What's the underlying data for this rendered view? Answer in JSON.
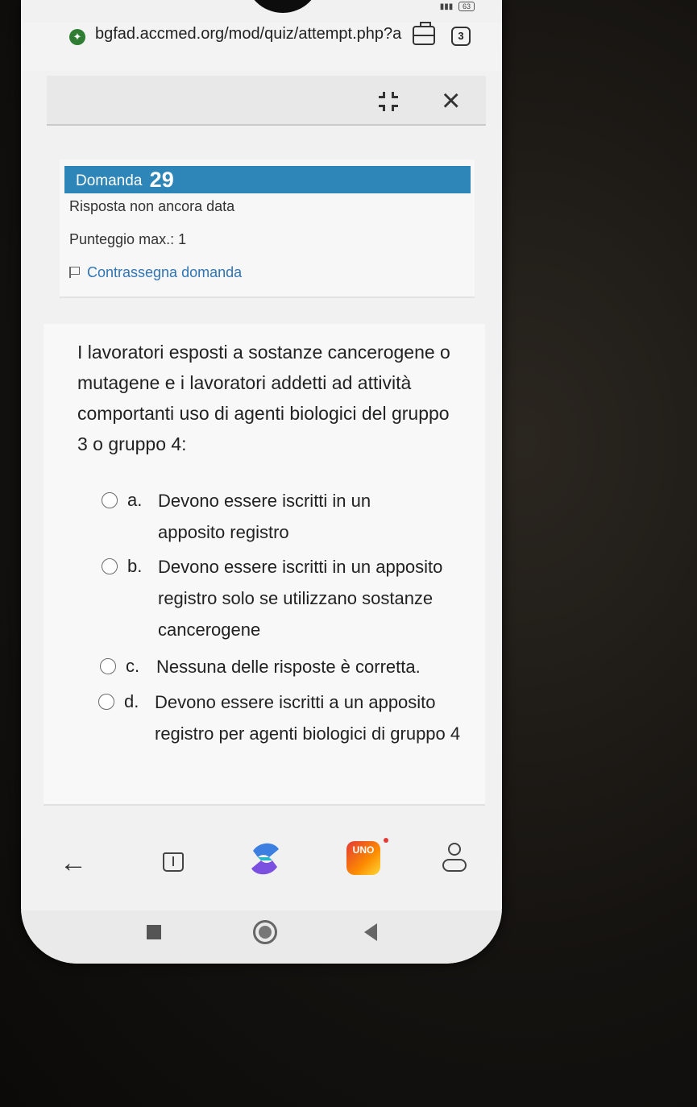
{
  "status_bar": {
    "battery": "63"
  },
  "browser": {
    "url": "bgfad.accmed.org/mod/quiz/attempt.php?a",
    "tab_count": "3"
  },
  "question": {
    "header_label": "Domanda",
    "number": "29",
    "status": "Risposta non ancora data",
    "max_score": "Punteggio max.: 1",
    "flag_label": "Contrassegna domanda",
    "text": "I lavoratori esposti a sostanze cancerogene o mutagene e i lavoratori addetti ad attività comportanti uso di agenti biologici del gruppo 3 o gruppo 4:",
    "options": [
      {
        "letter": "a.",
        "text": "Devono essere iscritti in un apposito registro"
      },
      {
        "letter": "b.",
        "text": "Devono essere iscritti in un apposito registro solo se utilizzano sostanze cancerogene"
      },
      {
        "letter": "c.",
        "text": "Nessuna delle risposte è corretta."
      },
      {
        "letter": "d.",
        "text": "Devono essere iscritti a un apposito registro per agenti biologici di gruppo 4"
      }
    ]
  },
  "bottom_nav": {
    "app_icon_label": "UNO"
  },
  "icons": {
    "site_security": "shield-icon",
    "briefcase": "briefcase-icon",
    "collapse": "collapse-icon",
    "close": "close-icon",
    "flag": "flag-icon",
    "back": "back-arrow-icon",
    "book": "book-icon",
    "copilot": "copilot-icon",
    "profile": "profile-icon"
  }
}
